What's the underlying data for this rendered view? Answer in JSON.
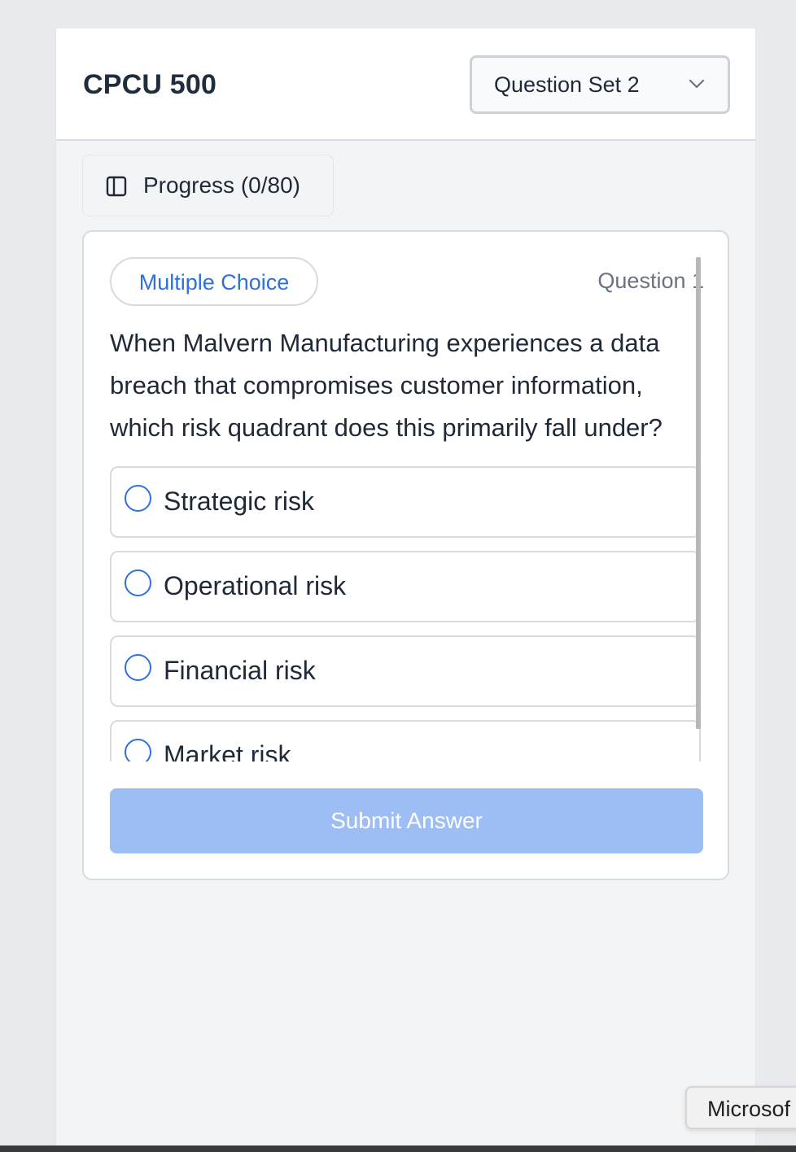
{
  "header": {
    "course_title": "CPCU 500",
    "question_set": "Question Set 2"
  },
  "progress": {
    "label": "Progress (0/80)"
  },
  "question": {
    "type_badge": "Multiple Choice",
    "number_label": "Question 1",
    "text": "When Malvern Manufacturing experiences a data breach that compromises customer information, which risk quadrant does this primarily fall under?",
    "options": [
      {
        "label": "Strategic risk"
      },
      {
        "label": "Operational risk"
      },
      {
        "label": "Financial risk"
      },
      {
        "label": "Market risk"
      }
    ]
  },
  "submit_label": "Submit Answer",
  "toast": {
    "text": "Microsof"
  },
  "colors": {
    "accent": "#2f6fde",
    "submit_disabled": "#9dbdf5",
    "page_bg": "#f3f4f6"
  }
}
